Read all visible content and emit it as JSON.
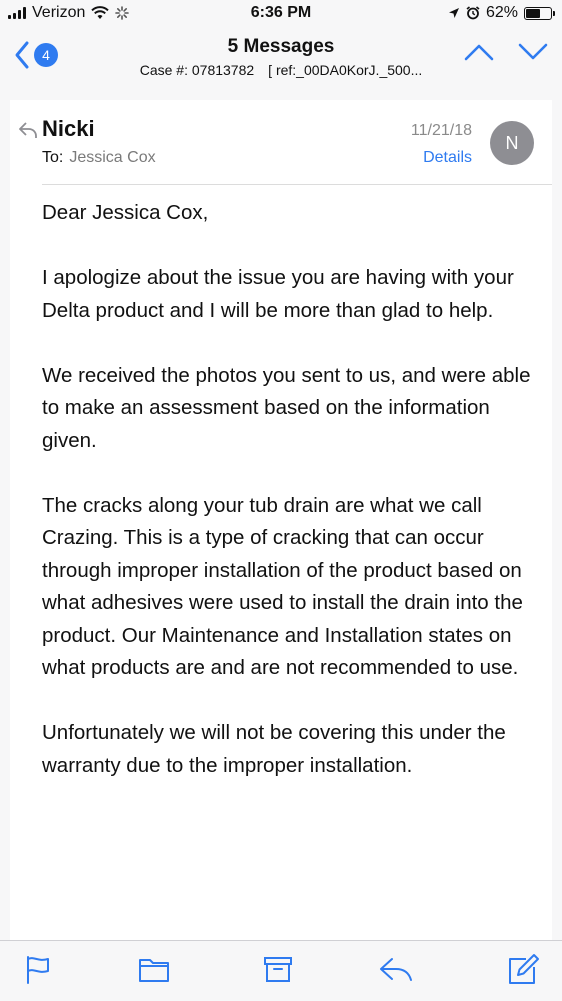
{
  "status_bar": {
    "carrier": "Verizon",
    "time": "6:36 PM",
    "battery": "62%",
    "battery_level": 0.62
  },
  "nav": {
    "back_count": "4",
    "title": "5 Messages",
    "case": "Case #: 07813782",
    "ref": "[ ref:_00DA0KorJ._500..."
  },
  "message": {
    "sender": "Nicki",
    "to_label": "To:",
    "recipient": "Jessica Cox",
    "date": "11/21/18",
    "details_label": "Details",
    "avatar_initial": "N",
    "body": [
      "Dear Jessica Cox,",
      "I apologize about the issue you are having with your Delta product and I will be more than glad to help.",
      "We received the photos you sent to us, and were able to make an assessment based on the information given.",
      "The cracks along your tub drain are what we call Crazing. This is a type of cracking that can occur through improper installation of the product based on what adhesives were used to install the drain into the product. Our Maintenance and Installation states on what products are and are not recommended to use.",
      "Unfortunately we will not be covering this under the warranty due to the improper installation."
    ]
  },
  "toolbar": {
    "icons": [
      "flag-icon",
      "folder-icon",
      "archive-icon",
      "reply-icon",
      "compose-icon"
    ]
  },
  "colors": {
    "accent": "#2f7bf0",
    "avatar": "#8e8e93"
  }
}
